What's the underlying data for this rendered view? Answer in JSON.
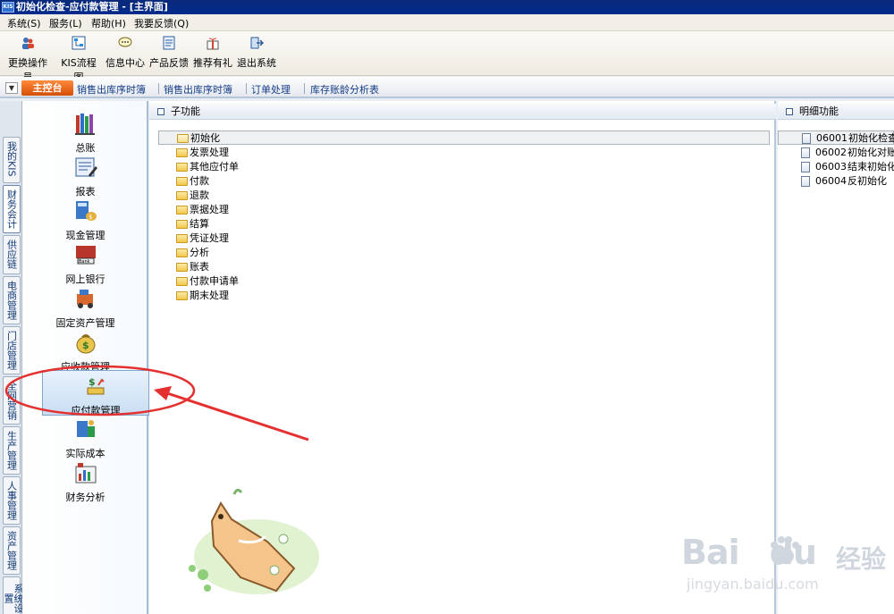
{
  "window": {
    "logo": "KIS",
    "title": "初始化检查-应付款管理 - [主界面]"
  },
  "menu": [
    "系统(S)",
    "服务(L)",
    "帮助(H)",
    "我要反馈(Q)"
  ],
  "toolbar": [
    {
      "label": "更换操作员",
      "icon": "user-switch-icon"
    },
    {
      "label": "KIS流程图",
      "icon": "flowchart-icon"
    },
    {
      "label": "信息中心",
      "icon": "message-icon"
    },
    {
      "label": "产品反馈",
      "icon": "feedback-icon"
    },
    {
      "label": "推荐有礼",
      "icon": "gift-icon"
    },
    {
      "label": "退出系统",
      "icon": "exit-icon"
    }
  ],
  "tabs": {
    "dropdown_glyph": "▼",
    "active": "主控台",
    "items": [
      "销售出库序时簿",
      "销售出库序时簿",
      "订单处理",
      "库存账龄分析表"
    ]
  },
  "vertical_nav": [
    "我的KIS",
    "财务会计",
    "供应链",
    "电商管理",
    "门店管理",
    "全网营销",
    "生产管理",
    "人事管理",
    "资产管理",
    "系统设置"
  ],
  "modules": [
    {
      "label": "总账",
      "icon": "ledger-books-icon"
    },
    {
      "label": "报表",
      "icon": "report-icon"
    },
    {
      "label": "现金管理",
      "icon": "cash-icon"
    },
    {
      "label": "网上银行",
      "icon": "bank-icon",
      "icon_text": "Bank"
    },
    {
      "label": "固定资产管理",
      "icon": "fixed-asset-icon"
    },
    {
      "label": "应收款管理",
      "icon": "money-bag-icon"
    },
    {
      "label": "应付款管理",
      "icon": "payable-icon",
      "selected": true
    },
    {
      "label": "实际成本",
      "icon": "cost-icon"
    },
    {
      "label": "财务分析",
      "icon": "analysis-icon"
    }
  ],
  "sub_panel": {
    "title": "子功能",
    "root": "初始化",
    "folders": [
      "发票处理",
      "其他应付单",
      "付款",
      "退款",
      "票据处理",
      "结算",
      "凭证处理",
      "分析",
      "账表",
      "付款申请单",
      "期末处理"
    ]
  },
  "detail_panel": {
    "title": "明细功能",
    "items": [
      {
        "code": "06001",
        "name": "初始化检查"
      },
      {
        "code": "06002",
        "name": "初始化对账"
      },
      {
        "code": "06003",
        "name": "结束初始化"
      },
      {
        "code": "06004",
        "name": "反初始化"
      }
    ]
  },
  "watermark": {
    "brand": "Bai",
    "brand2": "du",
    "cn": "经验",
    "url": "jingyan.baidu.com"
  },
  "colors": {
    "title_bg": "#0a2a7a",
    "tab_active": "#e8660f",
    "annotation": "#e53030"
  }
}
